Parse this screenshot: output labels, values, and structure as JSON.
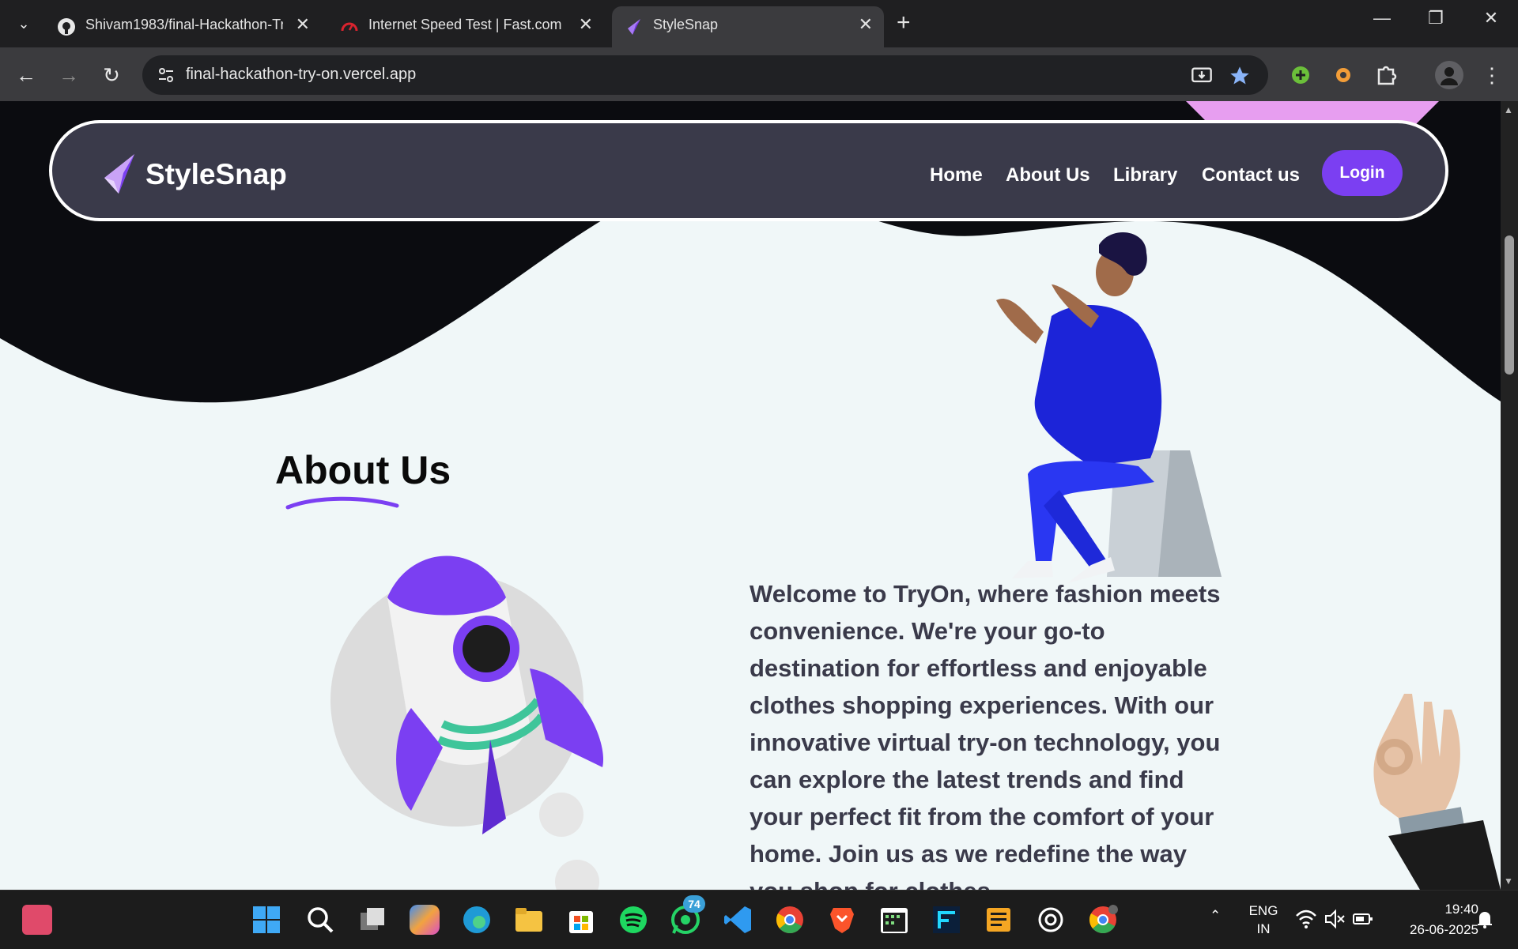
{
  "browser": {
    "tabs": [
      {
        "title": "Shivam1983/final-Hackathon-Tr",
        "icon": "github-icon"
      },
      {
        "title": "Internet Speed Test | Fast.com",
        "icon": "speedometer-icon"
      },
      {
        "title": "StyleSnap",
        "icon": "stylesnap-logo-icon",
        "active": true
      }
    ],
    "url": "final-hackathon-try-on.vercel.app"
  },
  "site": {
    "brand": "StyleSnap",
    "nav": [
      "Home",
      "About Us",
      "Library",
      "Contact us"
    ],
    "login_label": "Login",
    "about_title": "About Us",
    "about_text": "Welcome to TryOn, where fashion meets convenience. We're your go-to destination for effortless and enjoyable clothes shopping experiences. With our innovative virtual try-on technology, you can explore the latest trends and find your perfect fit from the comfort of your home. Join us as we redefine the way you shop for clothes.",
    "colors": {
      "accent": "#7b3ff2",
      "navbar": "#3a3a4a",
      "page_bg": "#f0f7f8",
      "dark": "#0b0c10"
    }
  },
  "taskbar": {
    "whatsapp_badge": "74",
    "lang_line1": "ENG",
    "lang_line2": "IN",
    "time": "19:40",
    "date": "26-06-2025"
  }
}
